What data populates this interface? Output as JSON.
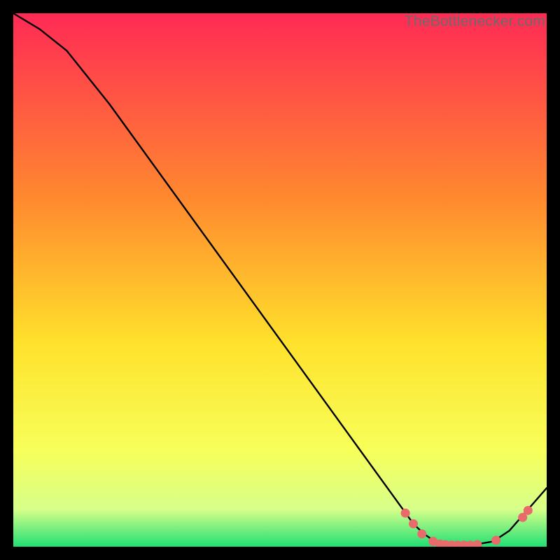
{
  "watermark": "TheBottlenecker.com",
  "colors": {
    "gradient_top": "#ff2a55",
    "gradient_mid_upper": "#ff8a2e",
    "gradient_mid": "#ffe22c",
    "gradient_mid_lower": "#f7ff5a",
    "gradient_lower": "#d7ff8a",
    "gradient_bottom": "#20e074",
    "curve": "#000000",
    "marker_fill": "#e86a6a",
    "marker_stroke": "#d94f4f"
  },
  "chart_data": {
    "type": "line",
    "title": "",
    "xlabel": "",
    "ylabel": "",
    "xlim": [
      0,
      100
    ],
    "ylim": [
      0,
      100
    ],
    "curve": [
      {
        "x": 0,
        "y": 100
      },
      {
        "x": 5,
        "y": 97
      },
      {
        "x": 10,
        "y": 93
      },
      {
        "x": 14,
        "y": 88
      },
      {
        "x": 18,
        "y": 83
      },
      {
        "x": 75,
        "y": 4.3
      },
      {
        "x": 77,
        "y": 2.4
      },
      {
        "x": 79,
        "y": 1.0
      },
      {
        "x": 82,
        "y": 0.3
      },
      {
        "x": 86,
        "y": 0.3
      },
      {
        "x": 90,
        "y": 1.0
      },
      {
        "x": 93,
        "y": 3.0
      },
      {
        "x": 100,
        "y": 11.0
      }
    ],
    "markers": [
      {
        "x": 73.5,
        "y": 6.3
      },
      {
        "x": 75.0,
        "y": 4.3
      },
      {
        "x": 76.6,
        "y": 2.4
      },
      {
        "x": 78.7,
        "y": 1.0
      },
      {
        "x": 80.0,
        "y": 0.5
      },
      {
        "x": 81.0,
        "y": 0.4
      },
      {
        "x": 82.2,
        "y": 0.3
      },
      {
        "x": 83.3,
        "y": 0.3
      },
      {
        "x": 84.5,
        "y": 0.3
      },
      {
        "x": 85.7,
        "y": 0.3
      },
      {
        "x": 87.0,
        "y": 0.4
      },
      {
        "x": 90.5,
        "y": 1.2
      },
      {
        "x": 95.5,
        "y": 5.5
      },
      {
        "x": 96.5,
        "y": 6.8
      }
    ]
  }
}
